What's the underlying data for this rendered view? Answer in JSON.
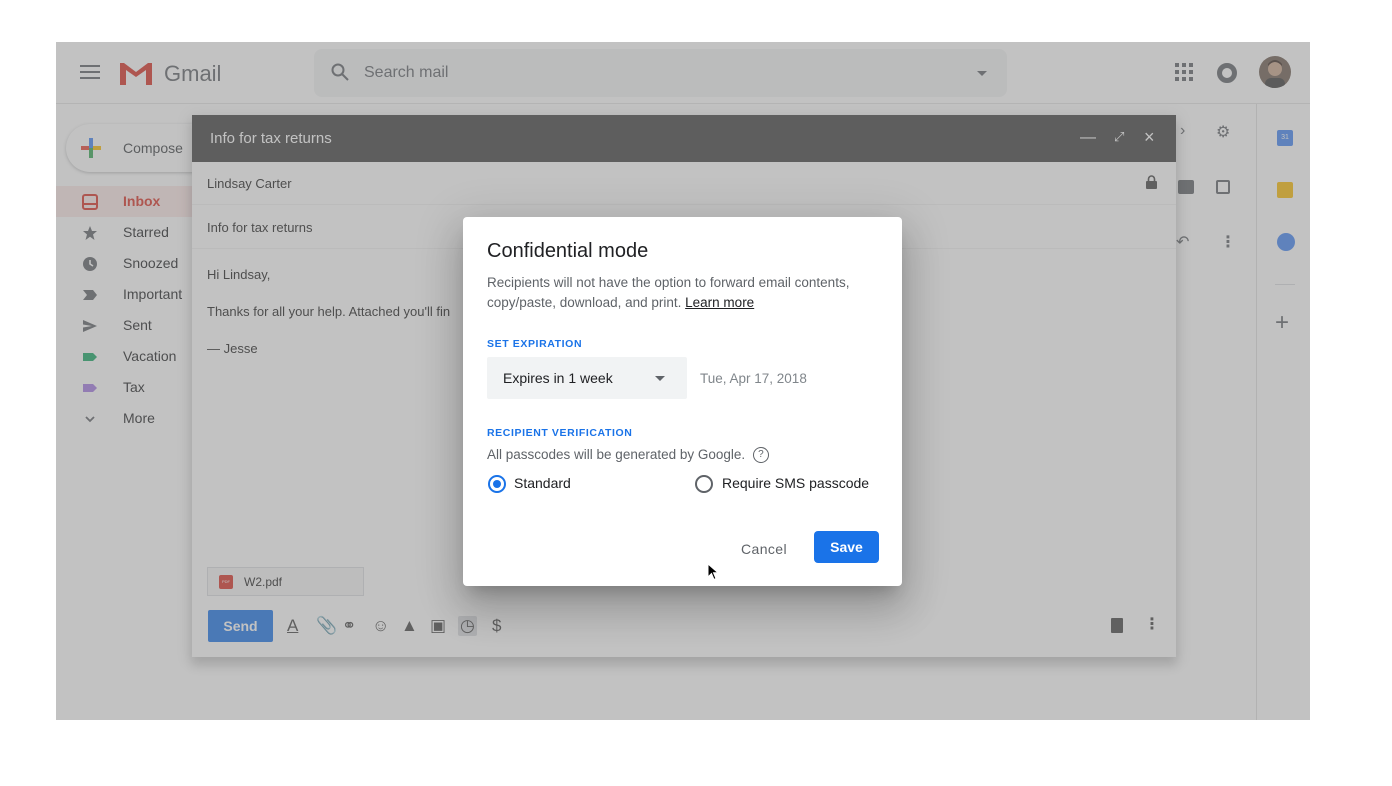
{
  "app": {
    "name": "Gmail"
  },
  "search": {
    "placeholder": "Search mail"
  },
  "compose_button": {
    "label": "Compose"
  },
  "nav": {
    "items": [
      {
        "label": "Inbox",
        "icon": "inbox-icon",
        "active": true
      },
      {
        "label": "Starred",
        "icon": "star-icon"
      },
      {
        "label": "Snoozed",
        "icon": "clock-icon"
      },
      {
        "label": "Important",
        "icon": "important-icon"
      },
      {
        "label": "Sent",
        "icon": "send-icon"
      },
      {
        "label": "Vacation",
        "icon": "label-icon",
        "color": "#16a765"
      },
      {
        "label": "Tax",
        "icon": "label-icon",
        "color": "#a479e2"
      },
      {
        "label": "More",
        "icon": "chevron-down-icon"
      }
    ]
  },
  "compose": {
    "title": "Info for tax returns",
    "to": "Lindsay Carter",
    "subject": "Info for tax returns",
    "body": {
      "greeting": "Hi Lindsay,",
      "line": "Thanks for all your help. Attached you'll fin",
      "signature": "— Jesse"
    },
    "attachment": {
      "name": "W2.pdf",
      "badge": "PDF"
    },
    "send_label": "Send",
    "format_symbol": "A",
    "money_symbol": "$"
  },
  "sidebar_calendar_day": "31",
  "dialog": {
    "title": "Confidential mode",
    "description": "Recipients will not have the option to forward email contents, copy/paste, download, and print.",
    "learn_more": "Learn more",
    "expiration_label": "SET EXPIRATION",
    "expiry_selected": "Expires in 1 week",
    "expiry_date": "Tue, Apr 17, 2018",
    "verification_label": "RECIPIENT VERIFICATION",
    "verification_note": "All passcodes will be generated by Google.",
    "help_symbol": "?",
    "option_standard": "Standard",
    "option_sms": "Require SMS passcode",
    "selected_option": "Standard",
    "cancel_label": "Cancel",
    "save_label": "Save"
  },
  "colors": {
    "accent": "#1a73e8",
    "gmail_red": "#d93025",
    "compose_header": "#404040"
  }
}
